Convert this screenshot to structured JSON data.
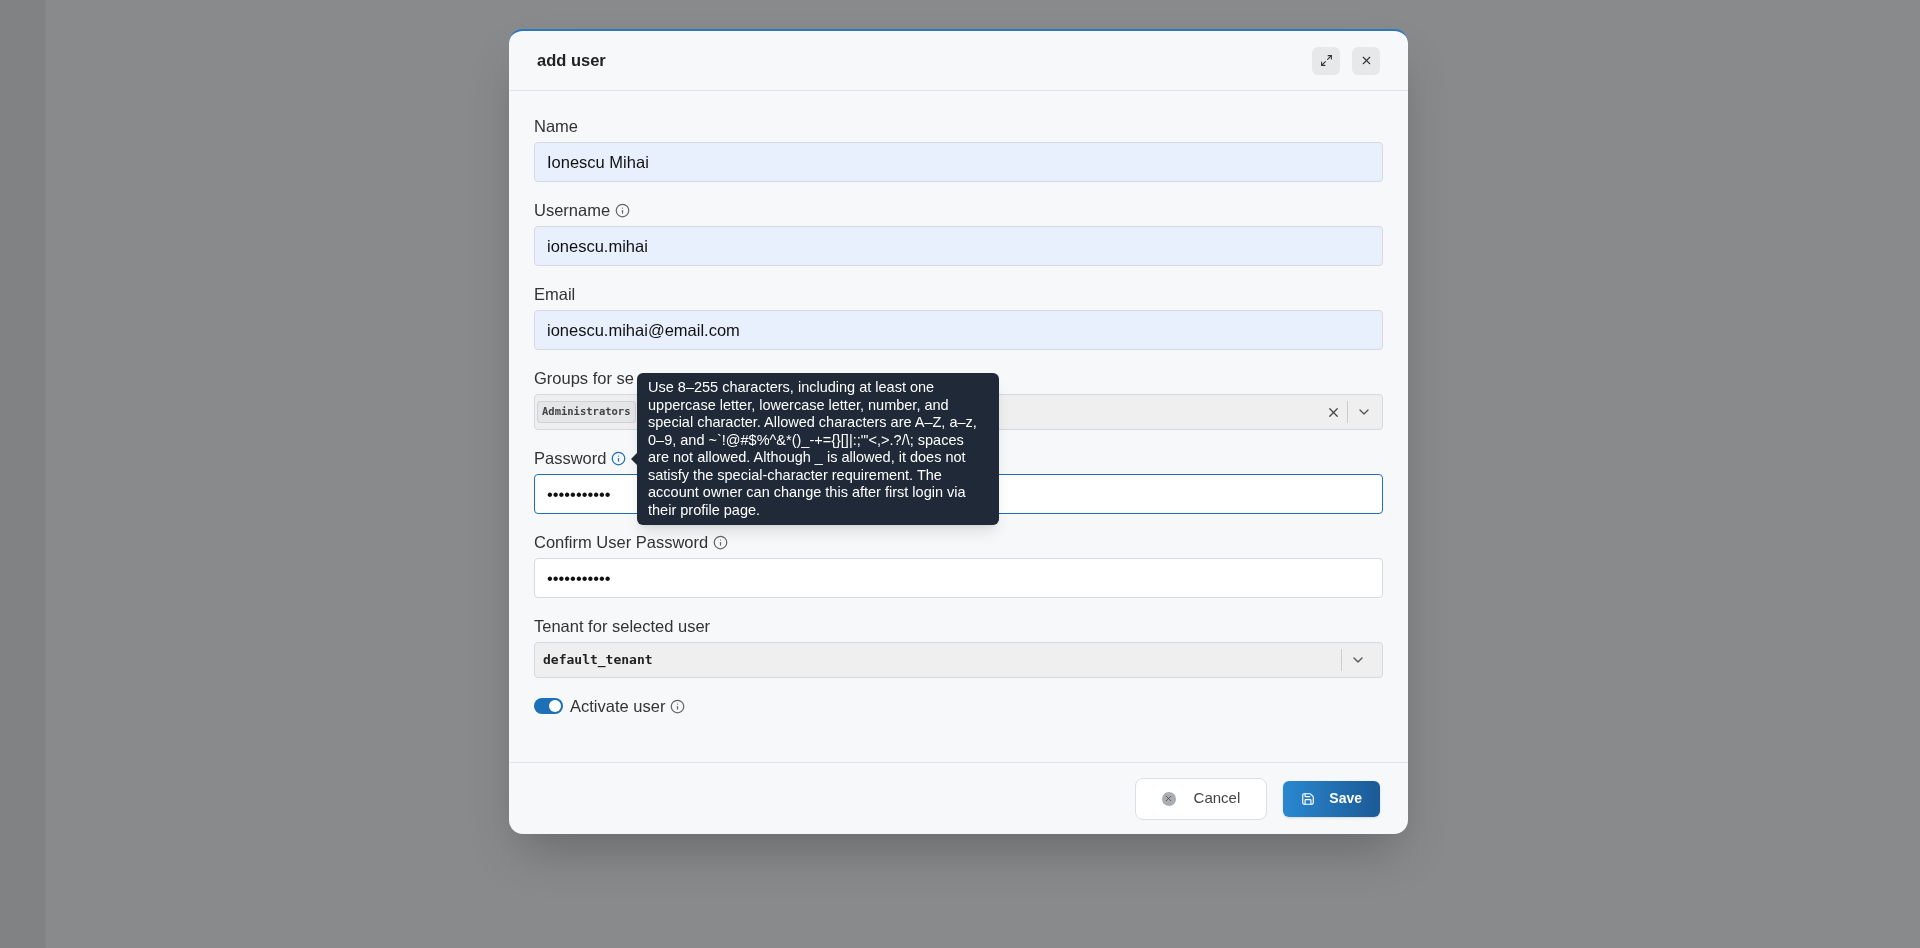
{
  "dialog": {
    "title": "add user",
    "fields": [
      {
        "kind": "text",
        "label": "Name",
        "info": false,
        "value": "Ionescu Mihai",
        "autofilled": true,
        "focused": false
      },
      {
        "kind": "text",
        "label": "Username",
        "info": true,
        "value": "ionescu.mihai",
        "autofilled": true,
        "focused": false
      },
      {
        "kind": "text",
        "label": "Email",
        "info": false,
        "value": "ionescu.mihai@email.com",
        "autofilled": true,
        "focused": false
      },
      {
        "kind": "multiselect",
        "label": "Groups for se",
        "info": false,
        "chips": [
          "Administrators"
        ]
      },
      {
        "kind": "password",
        "label": "Password",
        "info": true,
        "value": "•••••••••••",
        "autofilled": false,
        "focused": true
      },
      {
        "kind": "password",
        "label": "Confirm User Password",
        "info": true,
        "value": "•••••••••••",
        "autofilled": false,
        "focused": false
      },
      {
        "kind": "select",
        "label": "Tenant for selected user",
        "info": false,
        "value": "default_tenant"
      }
    ],
    "toggle": {
      "label": "Activate user",
      "on": true,
      "info": true
    },
    "tooltip": "Use 8–255 characters, including at least one uppercase letter, lowercase letter, number, and special character. Allowed characters are A–Z, a–z, 0–9, and ~`!@#$%^&*()_-+={}[]|:;\"'<,>.?/\\; spaces are not allowed. Although _ is allowed, it does not satisfy the special-character requirement. The account owner can change this after first login via their profile page.",
    "buttons": [
      {
        "kind": "secondary",
        "label": "Cancel"
      },
      {
        "kind": "primary",
        "label": "Save"
      }
    ]
  }
}
